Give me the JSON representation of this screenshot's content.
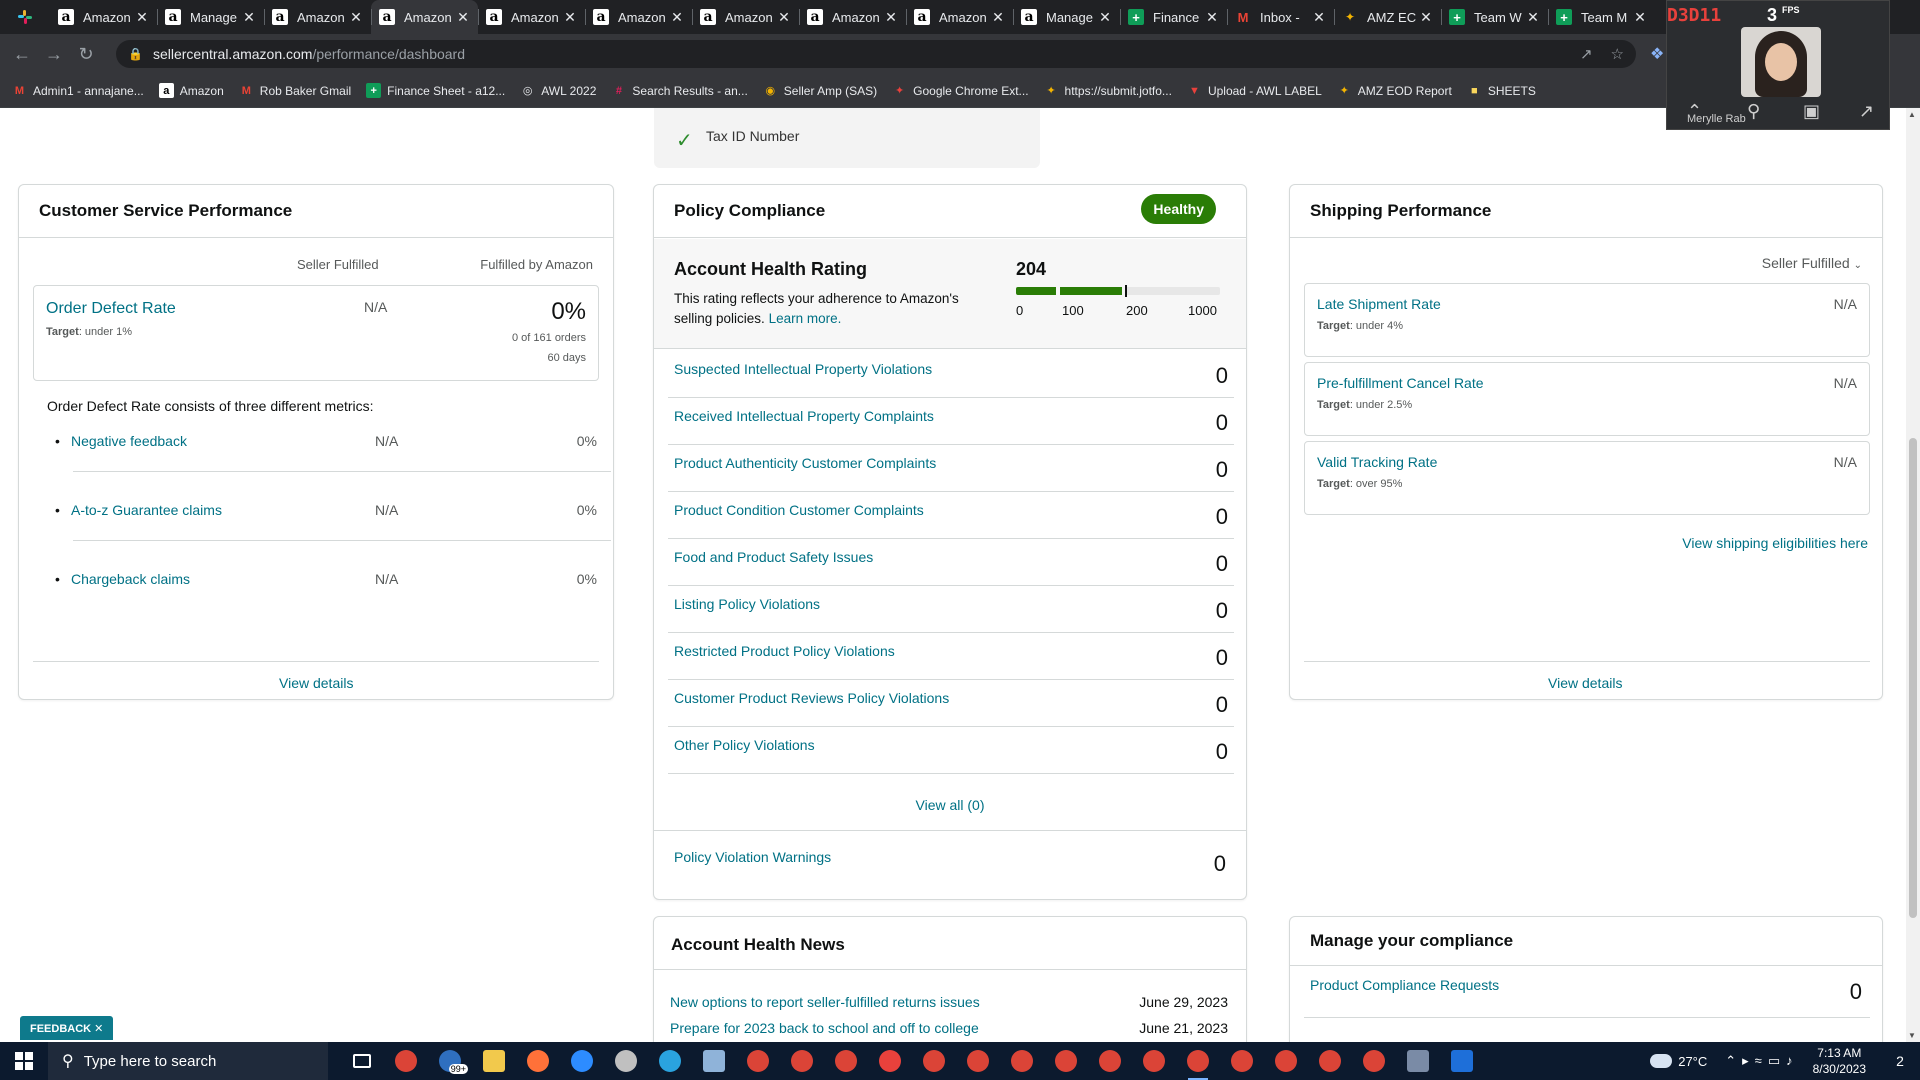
{
  "browser": {
    "tabs": [
      {
        "title": "Amazon",
        "icon": "amz"
      },
      {
        "title": "Manage",
        "icon": "amz"
      },
      {
        "title": "Amazon",
        "icon": "amz"
      },
      {
        "title": "Amazon",
        "icon": "amz",
        "active": true
      },
      {
        "title": "Amazon",
        "icon": "amz"
      },
      {
        "title": "Amazon",
        "icon": "amz"
      },
      {
        "title": "Amazon",
        "icon": "amz"
      },
      {
        "title": "Amazon",
        "icon": "amz"
      },
      {
        "title": "Amazon",
        "icon": "amz"
      },
      {
        "title": "Manage",
        "icon": "amz"
      },
      {
        "title": "Finance",
        "icon": "sheet"
      },
      {
        "title": "Inbox -",
        "icon": "gmail"
      },
      {
        "title": "AMZ EC",
        "icon": "eod"
      },
      {
        "title": "Team W",
        "icon": "sheet"
      },
      {
        "title": "Team M",
        "icon": "sheet"
      }
    ],
    "url_host": "sellercentral.amazon.com",
    "url_path": "/performance/dashboard",
    "bookmarks": [
      {
        "label": "Admin1 - annajane...",
        "icon": "gmail"
      },
      {
        "label": "Amazon",
        "icon": "amz"
      },
      {
        "label": "Rob Baker Gmail",
        "icon": "gmail"
      },
      {
        "label": "Finance Sheet - a12...",
        "icon": "sheet"
      },
      {
        "label": "AWL 2022",
        "icon": "globe"
      },
      {
        "label": "Search Results - an...",
        "icon": "slack"
      },
      {
        "label": "Seller Amp (SAS)",
        "icon": "sas"
      },
      {
        "label": "Google Chrome Ext...",
        "icon": "ext"
      },
      {
        "label": "https://submit.jotfo...",
        "icon": "jot"
      },
      {
        "label": "Upload - AWL LABEL",
        "icon": "awl"
      },
      {
        "label": "AMZ EOD Report",
        "icon": "eod"
      },
      {
        "label": "SHEETS",
        "icon": "folder"
      }
    ]
  },
  "webcam": {
    "fps_value": "D3D11",
    "fps_count": "3",
    "fps_label": "FPS",
    "name": "Merylle Rab"
  },
  "tax_id": {
    "label": "Tax ID Number"
  },
  "customer_service": {
    "title": "Customer Service Performance",
    "col_seller": "Seller Fulfilled",
    "col_fba": "Fulfilled by Amazon",
    "odr_name": "Order Defect Rate",
    "odr_target_label": "Target",
    "odr_target": ": under 1%",
    "odr_seller": "N/A",
    "odr_value": "0%",
    "odr_orders": "0 of 161 orders",
    "odr_days": "60 days",
    "odr_description": "Order Defect Rate consists of three different metrics:",
    "metrics": [
      {
        "name": "Negative feedback",
        "seller": "N/A",
        "fba": "0%"
      },
      {
        "name": "A-to-z Guarantee claims",
        "seller": "N/A",
        "fba": "0%"
      },
      {
        "name": "Chargeback claims",
        "seller": "N/A",
        "fba": "0%"
      }
    ],
    "view_details": "View details"
  },
  "policy": {
    "title": "Policy Compliance",
    "status": "Healthy",
    "status_color": "#2a7d06",
    "ahr_title": "Account Health Rating",
    "ahr_desc": "This rating reflects your adherence to Amazon's selling policies.",
    "ahr_learn": "Learn more.",
    "ahr_score": "204",
    "ahr_scale": [
      "0",
      "100",
      "200",
      "1000"
    ],
    "rows": [
      {
        "name": "Suspected Intellectual Property Violations",
        "value": "0"
      },
      {
        "name": "Received Intellectual Property Complaints",
        "value": "0"
      },
      {
        "name": "Product Authenticity Customer Complaints",
        "value": "0"
      },
      {
        "name": "Product Condition Customer Complaints",
        "value": "0"
      },
      {
        "name": "Food and Product Safety Issues",
        "value": "0"
      },
      {
        "name": "Listing Policy Violations",
        "value": "0"
      },
      {
        "name": "Restricted Product Policy Violations",
        "value": "0"
      },
      {
        "name": "Customer Product Reviews Policy Violations",
        "value": "0"
      },
      {
        "name": "Other Policy Violations",
        "value": "0"
      }
    ],
    "view_all": "View all (0)",
    "warnings_name": "Policy Violation Warnings",
    "warnings_value": "0"
  },
  "shipping": {
    "title": "Shipping Performance",
    "selector": "Seller Fulfilled",
    "rows": [
      {
        "name": "Late Shipment Rate",
        "target_label": "Target",
        "target": ": under 4%",
        "value": "N/A"
      },
      {
        "name": "Pre-fulfillment Cancel Rate",
        "target_label": "Target",
        "target": ": under 2.5%",
        "value": "N/A"
      },
      {
        "name": "Valid Tracking Rate",
        "target_label": "Target",
        "target": ": over 95%",
        "value": "N/A"
      }
    ],
    "eligibility_link": "View shipping eligibilities here",
    "view_details": "View details"
  },
  "news": {
    "title": "Account Health News",
    "items": [
      {
        "title": "New options to report seller-fulfilled returns issues",
        "date": "June 29, 2023"
      },
      {
        "title": "Prepare for 2023 back to school and off to college",
        "date": "June 21, 2023"
      }
    ]
  },
  "compliance": {
    "title": "Manage your compliance",
    "row_name": "Product Compliance Requests",
    "row_value": "0"
  },
  "feedback": {
    "label": "FEEDBACK ✕"
  },
  "taskbar": {
    "search_placeholder": "Type here to search",
    "badge": "99+",
    "temperature": "27°C",
    "time": "7:13 AM",
    "date": "8/30/2023",
    "notifications": "2"
  }
}
